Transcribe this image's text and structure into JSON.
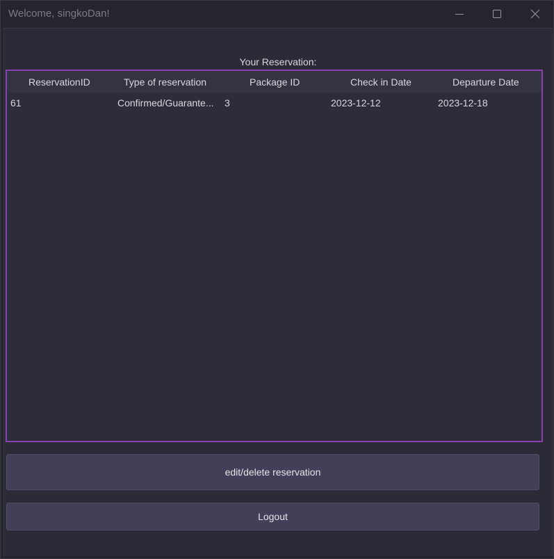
{
  "window": {
    "title": "Welcome, singkoDan!",
    "controls": {
      "minimize_icon": "minimize-icon",
      "maximize_icon": "maximize-icon",
      "close_icon": "close-icon"
    }
  },
  "main": {
    "heading": "Your Reservation:",
    "table": {
      "columns": [
        "ReservationID",
        "Type of reservation",
        "Package ID",
        "Check in Date",
        "Departure Date"
      ],
      "rows": [
        [
          "61",
          "Confirmed/Guarante...",
          "3",
          "2023-12-12",
          "2023-12-18"
        ]
      ]
    },
    "buttons": {
      "edit_label": "edit/delete reservation",
      "logout_label": "Logout"
    }
  },
  "colors": {
    "table_border": "#8b3fb0",
    "button_bg": "#433f58",
    "content_bg": "#2b2b37"
  }
}
